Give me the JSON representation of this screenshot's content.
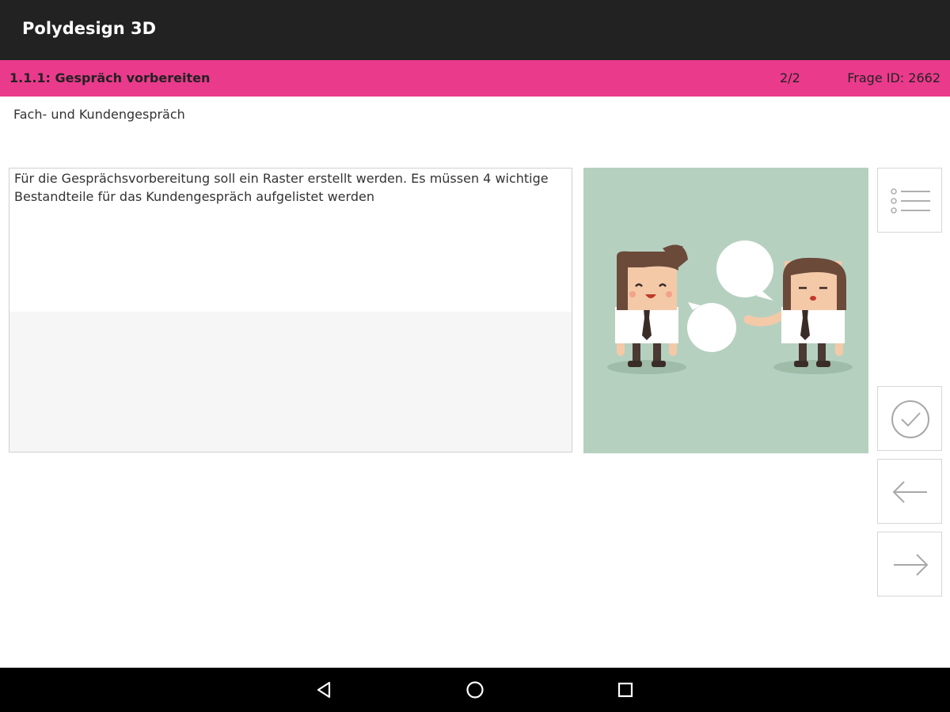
{
  "app": {
    "title": "Polydesign 3D"
  },
  "category": {
    "title": "1.1.1: Gespräch vorbereiten",
    "progress": "2/2",
    "question_id": "Frage ID: 2662"
  },
  "subtitle": "Fach- und Kundengespräch",
  "question": {
    "text": "Für die Gesprächsvorbereitung soll ein Raster erstellt werden. Es müssen 4 wichtige Bestandteile für das Kundengespräch aufgelistet werden"
  },
  "colors": {
    "accent": "#ea3a8c",
    "appbar": "#222222",
    "illustration_bg": "#b6d0c0"
  },
  "icons": {
    "list": "list-icon",
    "check": "check-circle-icon",
    "prev": "arrow-left-icon",
    "next": "arrow-right-icon",
    "nav_back": "triangle-back-icon",
    "nav_home": "circle-home-icon",
    "nav_recents": "square-recents-icon"
  }
}
